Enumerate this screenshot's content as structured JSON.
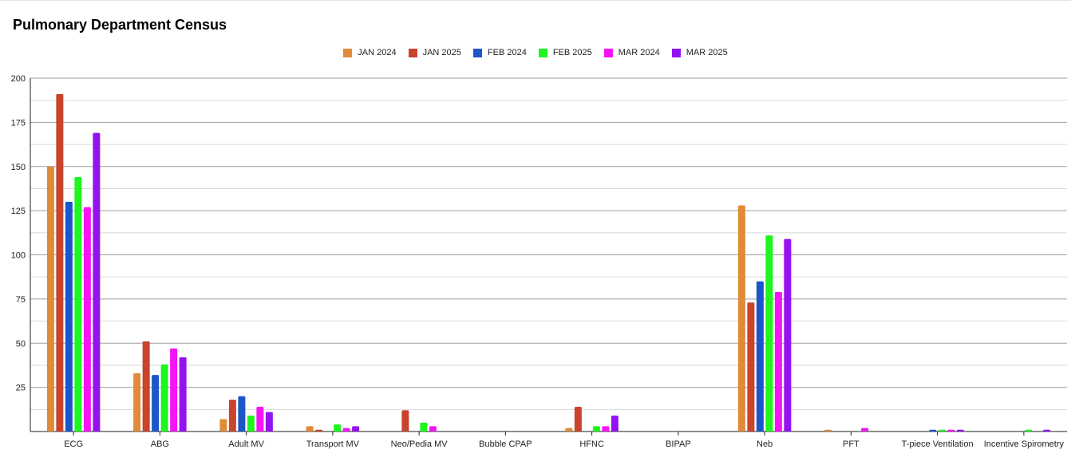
{
  "chart_data": {
    "type": "bar",
    "title": "Pulmonary Department Census",
    "xlabel": "",
    "ylabel": "",
    "ylim": [
      0,
      200
    ],
    "y_ticks": [
      25,
      50,
      75,
      100,
      125,
      150,
      175,
      200
    ],
    "grid": true,
    "legend_position": "top",
    "categories": [
      "ECG",
      "ABG",
      "Adult MV",
      "Transport MV",
      "Neo/Pedia MV",
      "Bubble CPAP",
      "HFNC",
      "BIPAP",
      "Neb",
      "PFT",
      "T-piece Ventilation",
      "Incentive Spirometry"
    ],
    "series": [
      {
        "name": "JAN 2024",
        "color": "#e08a3a",
        "values": [
          150,
          33,
          7,
          3,
          0,
          0,
          2,
          0,
          128,
          1,
          0,
          0
        ]
      },
      {
        "name": "JAN 2025",
        "color": "#c8442d",
        "values": [
          191,
          51,
          18,
          1,
          12,
          0,
          14,
          0,
          73,
          0,
          0,
          0
        ]
      },
      {
        "name": "FEB 2024",
        "color": "#1c56c8",
        "values": [
          130,
          32,
          20,
          0,
          0,
          0,
          0,
          0,
          85,
          0,
          1,
          0
        ]
      },
      {
        "name": "FEB 2025",
        "color": "#1ff51f",
        "values": [
          144,
          38,
          9,
          4,
          5,
          0,
          3,
          0,
          111,
          0,
          1,
          1
        ]
      },
      {
        "name": "MAR 2024",
        "color": "#f514f5",
        "values": [
          127,
          47,
          14,
          2,
          3,
          0,
          3,
          0,
          79,
          2,
          1,
          0
        ]
      },
      {
        "name": "MAR 2025",
        "color": "#9512f0",
        "values": [
          169,
          42,
          11,
          3,
          0,
          0,
          9,
          0,
          109,
          0,
          1,
          1
        ]
      }
    ]
  }
}
